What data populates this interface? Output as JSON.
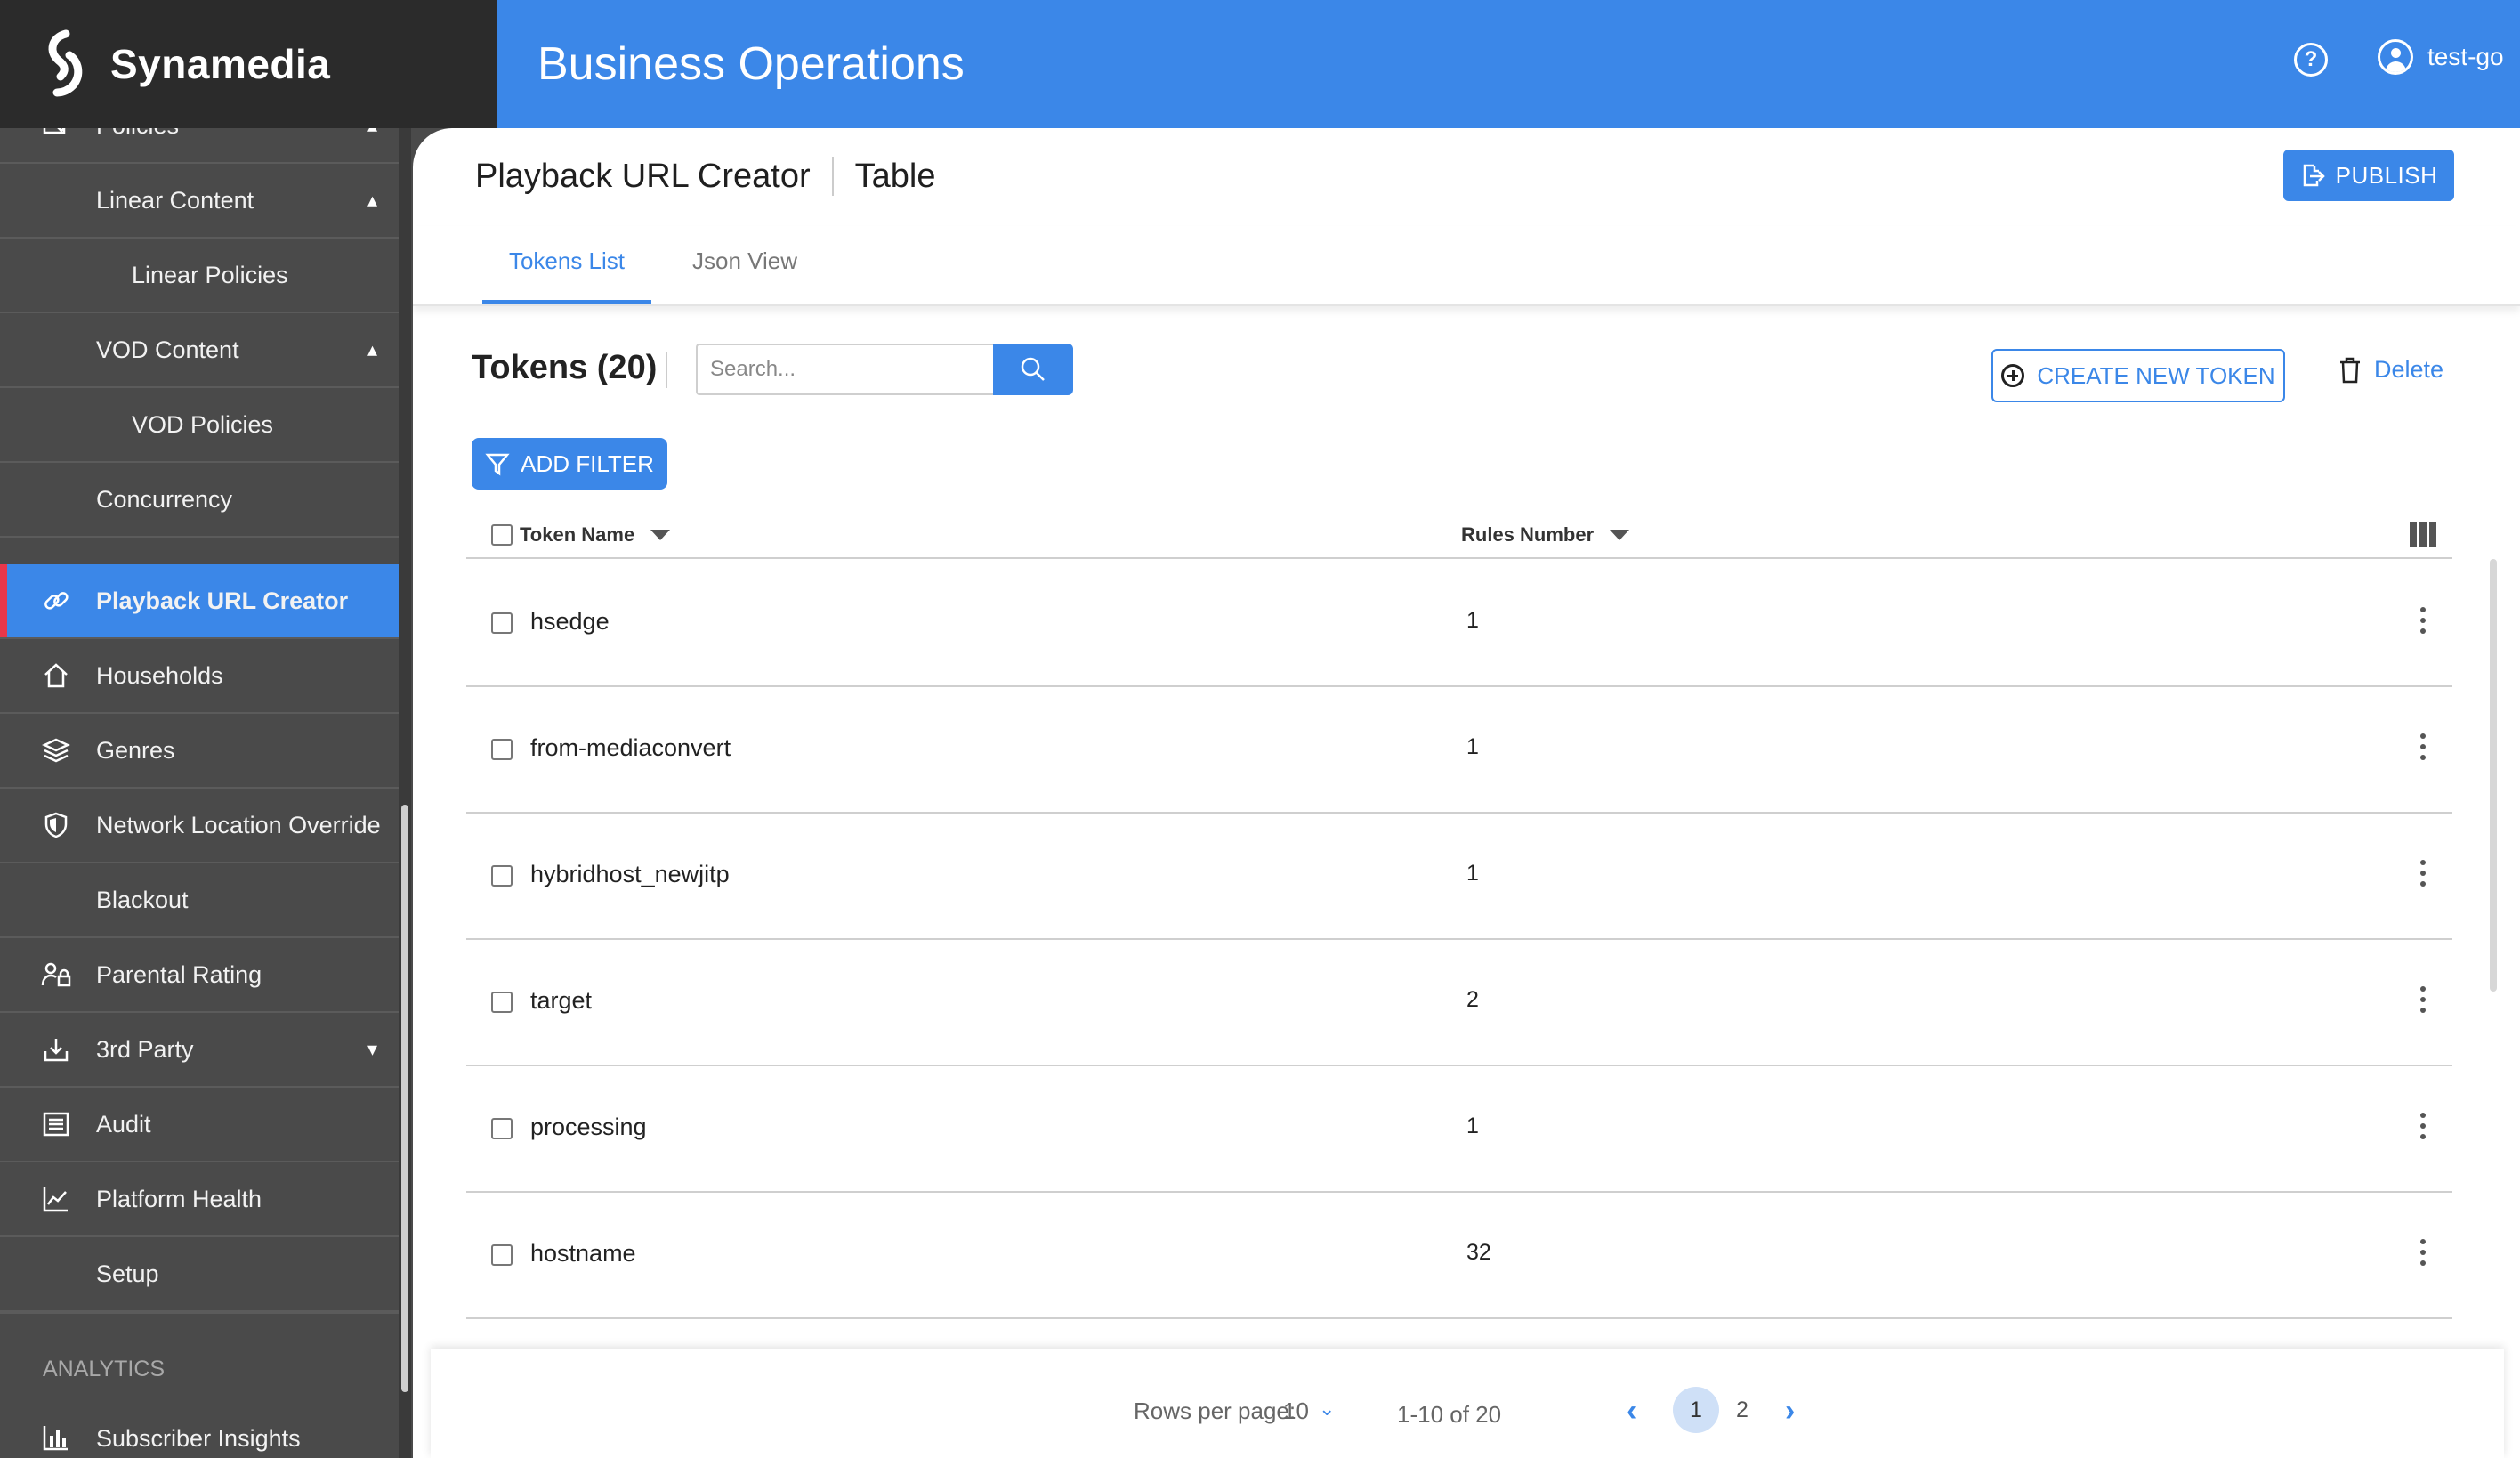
{
  "brand": {
    "name": "Synamedia"
  },
  "header": {
    "title": "Business Operations",
    "user": "test-go"
  },
  "sidebar": {
    "items": [
      {
        "label": "Policies",
        "icon": "policies-icon",
        "chevron": "up"
      },
      {
        "label": "Linear Content",
        "chevron": "up"
      },
      {
        "label": "Linear Policies"
      },
      {
        "label": "VOD Content",
        "chevron": "up"
      },
      {
        "label": "VOD Policies"
      },
      {
        "label": "Concurrency"
      },
      {
        "label": "Playback URL Creator",
        "icon": "link-icon",
        "active": true
      },
      {
        "label": "Households",
        "icon": "home-icon"
      },
      {
        "label": "Genres",
        "icon": "layers-icon"
      },
      {
        "label": "Network Location Override",
        "icon": "shield-icon"
      },
      {
        "label": "Blackout"
      },
      {
        "label": "Parental Rating",
        "icon": "parental-lock-icon"
      },
      {
        "label": "3rd Party",
        "icon": "download-icon",
        "chevron": "down"
      },
      {
        "label": "Audit",
        "icon": "list-icon"
      },
      {
        "label": "Platform Health",
        "icon": "chart-line-icon"
      },
      {
        "label": "Setup"
      }
    ],
    "analytics_section": "ANALYTICS",
    "analytics_items": [
      {
        "label": "Subscriber Insights",
        "icon": "bar-chart-icon"
      }
    ]
  },
  "page": {
    "title": "Playback URL Creator",
    "view": "Table",
    "publish_label": "PUBLISH",
    "tabs": [
      {
        "label": "Tokens List",
        "active": true
      },
      {
        "label": "Json View",
        "active": false
      }
    ]
  },
  "tokens": {
    "title": "Tokens (20)",
    "search_placeholder": "Search...",
    "create_label": "CREATE NEW TOKEN",
    "delete_label": "Delete",
    "filter_label": "ADD FILTER",
    "columns": [
      "Token Name",
      "Rules Number"
    ],
    "rows": [
      {
        "name": "hsedge",
        "rules": "1"
      },
      {
        "name": "from-mediaconvert",
        "rules": "1"
      },
      {
        "name": "hybridhost_newjitp",
        "rules": "1"
      },
      {
        "name": "target",
        "rules": "2"
      },
      {
        "name": "processing",
        "rules": "1"
      },
      {
        "name": "hostname",
        "rules": "32"
      }
    ]
  },
  "pagination": {
    "rows_per_page_label": "Rows per page:",
    "rows_per_page": "10",
    "range": "1-10 of 20",
    "pages": [
      "1",
      "2"
    ],
    "current_page": "1"
  },
  "colors": {
    "accent": "#3b87e8",
    "active_marker": "#e8374b",
    "sidebar_bg": "#4a4a4a",
    "brand_bg": "#2b2b2b"
  }
}
